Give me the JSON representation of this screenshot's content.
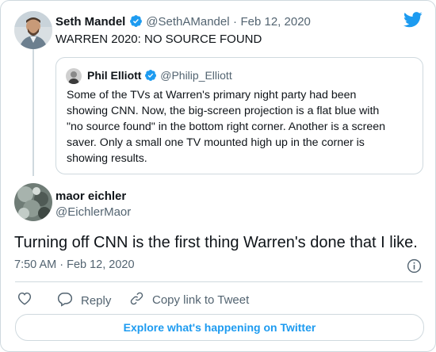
{
  "tweet": {
    "author": {
      "name": "Seth Mandel",
      "handle": "@SethAMandel",
      "date": "Feb 12, 2020"
    },
    "separator": "·",
    "text": "WARREN 2020: NO SOURCE FOUND",
    "quote": {
      "author": {
        "name": "Phil Elliott",
        "handle": "@Philip_Elliott"
      },
      "lines": [
        "Some of the TVs at Warren's primary night party had been",
        "showing CNN. Now, the big-screen projection is a flat blue with",
        "\"no source found\" in the bottom right corner. Another is a screen",
        "saver. Only a small one TV mounted high up in the corner is",
        "showing results."
      ]
    }
  },
  "reply": {
    "author": {
      "name": "maor eichler",
      "handle": "@EichlerMaor"
    },
    "text": "Turning off CNN is the first thing Warren's done that I like.",
    "time": "7:50 AM · Feb 12, 2020"
  },
  "actions": {
    "reply_label": "Reply",
    "copy_label": "Copy link to Tweet"
  },
  "explore_label": "Explore what's happening on Twitter",
  "icons": {
    "brand": "twitter-bird-icon",
    "verified": "verified-badge-icon",
    "info": "info-icon",
    "like": "heart-icon",
    "reply": "reply-bubble-icon",
    "copy": "link-icon"
  },
  "colors": {
    "accent": "#1d9bf0",
    "muted": "#536471",
    "border": "#cfd9de",
    "text": "#0f1419"
  }
}
